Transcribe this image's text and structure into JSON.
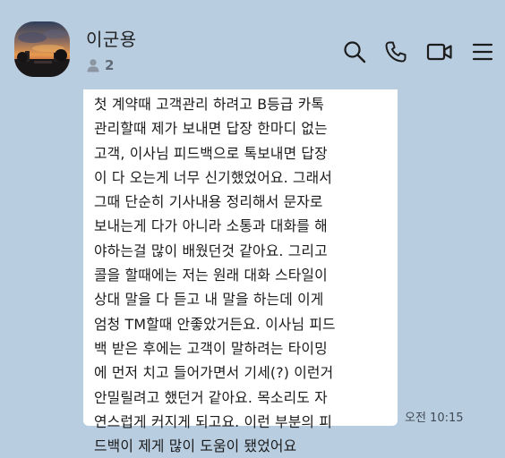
{
  "header": {
    "title": "이군용",
    "member_count": "2",
    "icons": [
      "search-icon",
      "phone-icon",
      "video-call-icon",
      "menu-icon"
    ]
  },
  "message": {
    "lines": [
      "첫 계약때 고객관리 하려고 B등급 카톡",
      "관리할때 제가 보내면 답장 한마디 없는",
      "고객, 이사님 피드백으로 톡보내면 답장",
      "이 다 오는게 너무 신기했었어요. 그래서",
      "그때 단순히 기사내용 정리해서 문자로",
      "보내는게 다가 아니라 소통과 대화를 해",
      "야하는걸 많이 배웠던것 같아요. 그리고",
      "콜을 할때에는 저는 원래 대화 스타일이",
      "상대 말을 다 듣고 내 말을 하는데 이게",
      "엄청 TM할때 안좋았거든요. 이사님 피드",
      "백 받은 후에는 고객이 말하려는 타이밍",
      "에 먼저 치고 들어가면서 기세(?) 이런거",
      "안밀릴려고 했던거 같아요. 목소리도 자",
      "연스럽게 커지게 되고요. 이런 부분의 피",
      "드백이 제게 많이 도움이 됐었어요"
    ],
    "timestamp": "오전 10:15"
  },
  "colors": {
    "background": "#b9cde0",
    "bubble": "#ffffff",
    "icon": "#1c1c1c"
  }
}
